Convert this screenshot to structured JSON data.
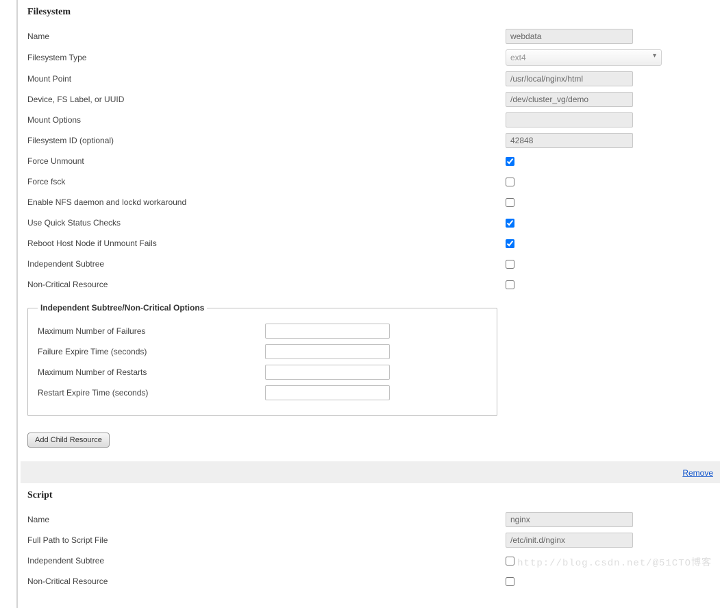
{
  "filesystem": {
    "title": "Filesystem",
    "fields": {
      "name": {
        "label": "Name",
        "value": "webdata"
      },
      "fstype": {
        "label": "Filesystem Type",
        "value": "ext4"
      },
      "mountpoint": {
        "label": "Mount Point",
        "value": "/usr/local/nginx/html"
      },
      "device": {
        "label": "Device, FS Label, or UUID",
        "value": "/dev/cluster_vg/demo"
      },
      "mountopts": {
        "label": "Mount Options",
        "value": ""
      },
      "fsid": {
        "label": "Filesystem ID (optional)",
        "value": "42848"
      },
      "force_unmount": {
        "label": "Force Unmount",
        "checked": true
      },
      "force_fsck": {
        "label": "Force fsck",
        "checked": false
      },
      "nfs_workaround": {
        "label": "Enable NFS daemon and lockd workaround",
        "checked": false
      },
      "quick_status": {
        "label": "Use Quick Status Checks",
        "checked": true
      },
      "reboot_fail": {
        "label": "Reboot Host Node if Unmount Fails",
        "checked": true
      },
      "indep_subtree": {
        "label": "Independent Subtree",
        "checked": false
      },
      "noncritical": {
        "label": "Non-Critical Resource",
        "checked": false
      }
    },
    "subtree": {
      "legend": "Independent Subtree/Non-Critical Options",
      "max_failures": {
        "label": "Maximum Number of Failures",
        "value": ""
      },
      "failure_expire": {
        "label": "Failure Expire Time (seconds)",
        "value": ""
      },
      "max_restarts": {
        "label": "Maximum Number of Restarts",
        "value": ""
      },
      "restart_expire": {
        "label": "Restart Expire Time (seconds)",
        "value": ""
      }
    },
    "add_child_button": "Add Child Resource"
  },
  "remove_link": "Remove",
  "script": {
    "title": "Script",
    "fields": {
      "name": {
        "label": "Name",
        "value": "nginx"
      },
      "path": {
        "label": "Full Path to Script File",
        "value": "/etc/init.d/nginx"
      },
      "indep_subtree": {
        "label": "Independent Subtree",
        "checked": false
      },
      "noncritical": {
        "label": "Non-Critical Resource",
        "checked": false
      }
    }
  },
  "watermark": "http://blog.csdn.net/@51CTO博客"
}
